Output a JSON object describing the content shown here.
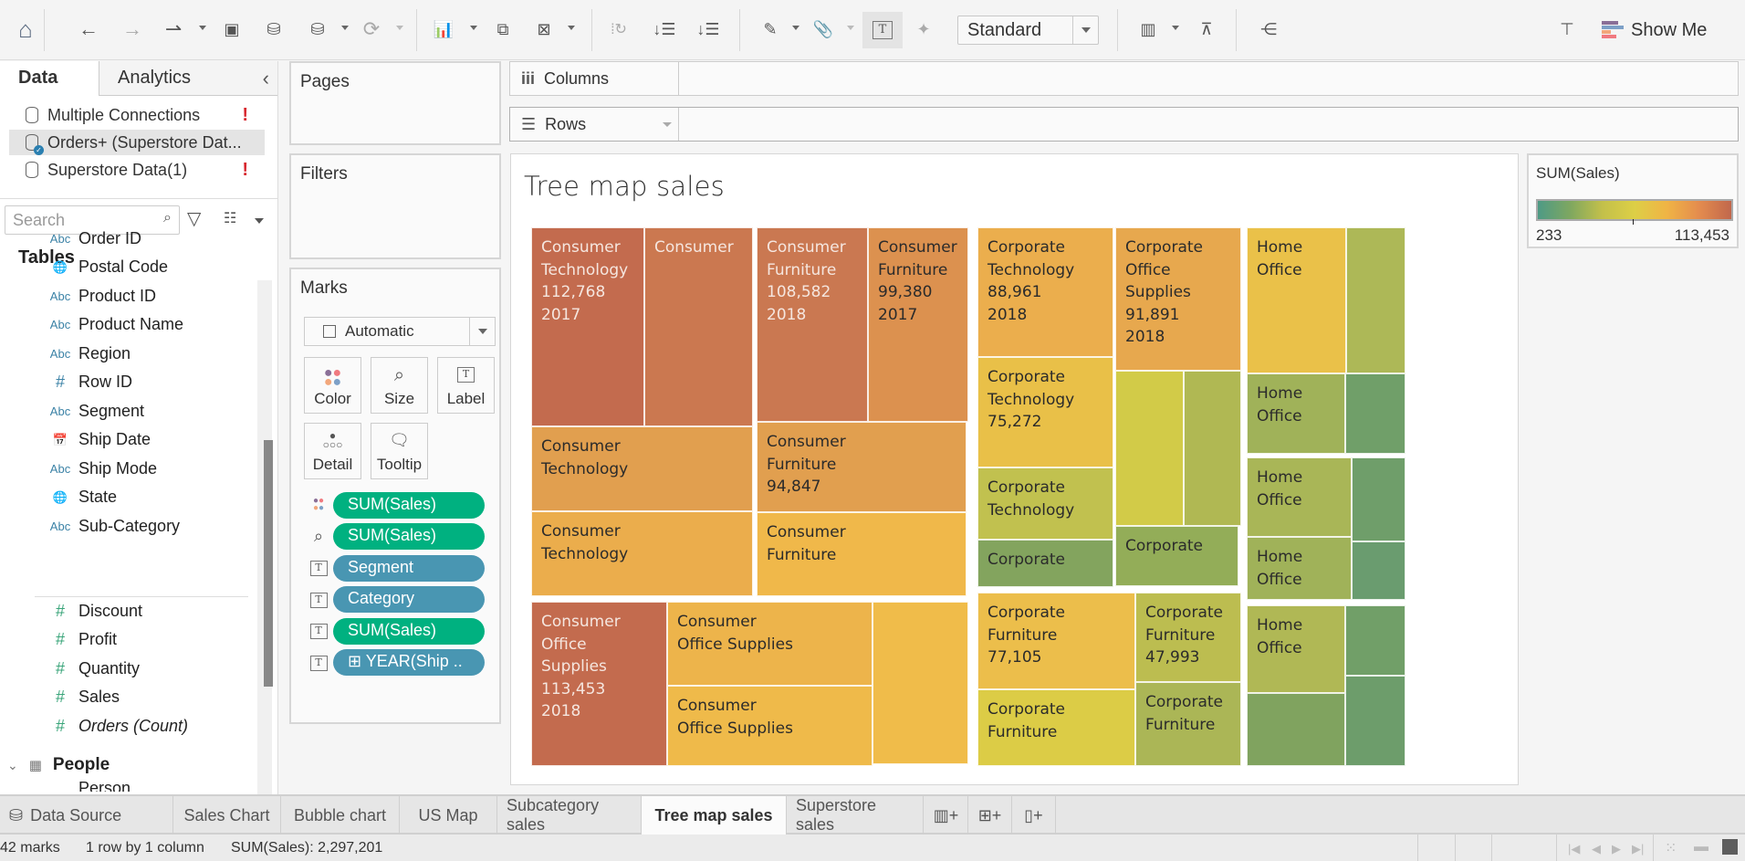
{
  "toolbar": {
    "icons": [
      "home-icon",
      "undo-icon",
      "redo-icon",
      "replay-icon",
      "save-icon",
      "new-data-source-icon",
      "pause-auto-updates-icon",
      "refresh-icon",
      "new-worksheet-icon",
      "duplicate-sheet-icon",
      "clear-sheet-icon",
      "swap-rows-columns-icon",
      "sort-ascending-icon",
      "sort-descending-icon",
      "highlight-icon",
      "group-icon",
      "show-mark-labels-icon",
      "pin-axes-icon",
      "show-cards-icon",
      "presentation-mode-icon",
      "share-icon",
      "guide-icon"
    ],
    "fit_select": "Standard",
    "show_me_label": "Show Me"
  },
  "data_pane": {
    "tabs": [
      "Data",
      "Analytics"
    ],
    "data_sources": [
      {
        "name": "Multiple Connections",
        "warning": "!"
      },
      {
        "name": "Orders+ (Superstore Dat...",
        "warning": "",
        "selected": true
      },
      {
        "name": "Superstore Data(1)",
        "warning": "!"
      }
    ],
    "search_placeholder": "Search",
    "tables_heading": "Tables",
    "dimension_fields": [
      {
        "type": "Abc",
        "name": "Order ID"
      },
      {
        "type": "globe",
        "name": "Postal Code"
      },
      {
        "type": "Abc",
        "name": "Product ID"
      },
      {
        "type": "Abc",
        "name": "Product Name"
      },
      {
        "type": "Abc",
        "name": "Region"
      },
      {
        "type": "#",
        "name": "Row ID"
      },
      {
        "type": "Abc",
        "name": "Segment"
      },
      {
        "type": "date",
        "name": "Ship Date"
      },
      {
        "type": "Abc",
        "name": "Ship Mode"
      },
      {
        "type": "globe",
        "name": "State"
      },
      {
        "type": "Abc",
        "name": "Sub-Category"
      }
    ],
    "measure_fields": [
      {
        "name": "Discount"
      },
      {
        "name": "Profit"
      },
      {
        "name": "Quantity"
      },
      {
        "name": "Sales"
      },
      {
        "name": "Orders (Count)",
        "italic": true
      }
    ],
    "people_table": "People",
    "people_first_field": "Person"
  },
  "cards": {
    "pages": "Pages",
    "filters": "Filters",
    "marks": "Marks",
    "mark_type": "Automatic",
    "mark_buttons": [
      "Color",
      "Size",
      "Label",
      "Detail",
      "Tooltip"
    ],
    "pills": [
      {
        "icon": "color",
        "label": "SUM(Sales)",
        "kind": "measure"
      },
      {
        "icon": "size",
        "label": "SUM(Sales)",
        "kind": "measure"
      },
      {
        "icon": "label",
        "label": "Segment",
        "kind": "dimension"
      },
      {
        "icon": "label",
        "label": "Category",
        "kind": "dimension"
      },
      {
        "icon": "label",
        "label": "SUM(Sales)",
        "kind": "measure"
      },
      {
        "icon": "label",
        "label": "⊞ YEAR(Ship ..",
        "kind": "dimension"
      }
    ]
  },
  "shelves": {
    "columns": "Columns",
    "rows": "Rows"
  },
  "view": {
    "title": "Tree map sales"
  },
  "legend": {
    "title": "SUM(Sales)",
    "min": "233",
    "max": "113,453",
    "colors": [
      "#4e9a86",
      "#ddcf46",
      "#c1674c"
    ]
  },
  "chart_data": {
    "type": "treemap",
    "title": "Tree map sales",
    "size_measure": "SUM(Sales)",
    "color_measure": "SUM(Sales)",
    "color_range": [
      233,
      113453
    ],
    "label_fields": [
      "Segment",
      "Category",
      "SUM(Sales)",
      "YEAR(Ship Date)"
    ],
    "total_marks": 42,
    "total_sales": 2297201,
    "cells": [
      {
        "lines": [
          "Consumer",
          "Technology",
          "112,768",
          "2017"
        ],
        "segment": "Consumer",
        "category": "Technology",
        "value": 112768,
        "year": "2017",
        "color": "#c36b4e",
        "text": "light"
      },
      {
        "lines": [
          "Consumer"
        ],
        "segment": "Consumer",
        "category": "Technology",
        "color": "#cb7850",
        "text": "light"
      },
      {
        "lines": [
          "Consumer",
          "Technology"
        ],
        "segment": "Consumer",
        "category": "Technology",
        "color": "#e19f4f",
        "text": "dark"
      },
      {
        "lines": [
          "Consumer",
          "Technology"
        ],
        "segment": "Consumer",
        "category": "Technology",
        "color": "#ebad4c",
        "text": "dark"
      },
      {
        "lines": [
          "Consumer",
          "Furniture",
          "108,582",
          "2018"
        ],
        "segment": "Consumer",
        "category": "Furniture",
        "value": 108582,
        "year": "2018",
        "color": "#ca7851",
        "text": "light"
      },
      {
        "lines": [
          "Consumer",
          "Furniture",
          "99,380",
          "2017"
        ],
        "segment": "Consumer",
        "category": "Furniture",
        "value": 99380,
        "year": "2017",
        "color": "#dc914f",
        "text": "dark"
      },
      {
        "lines": [
          "Consumer",
          "Furniture",
          "94,847"
        ],
        "segment": "Consumer",
        "category": "Furniture",
        "value": 94847,
        "color": "#e19f4f",
        "text": "dark"
      },
      {
        "lines": [
          "Consumer",
          "Furniture"
        ],
        "segment": "Consumer",
        "category": "Furniture",
        "color": "#f0b84a",
        "text": "dark"
      },
      {
        "lines": [
          "Consumer",
          "Office",
          "Supplies",
          "113,453",
          "2018"
        ],
        "segment": "Consumer",
        "category": "Office Supplies",
        "value": 113453,
        "year": "2018",
        "color": "#c36b4e",
        "text": "light"
      },
      {
        "lines": [
          "Consumer",
          "Office Supplies"
        ],
        "segment": "Consumer",
        "category": "Office Supplies",
        "color": "#edb44b",
        "text": "dark"
      },
      {
        "lines": [
          "Consumer",
          "Office Supplies"
        ],
        "segment": "Consumer",
        "category": "Office Supplies",
        "color": "#efba4a",
        "text": "dark"
      },
      {
        "lines": [],
        "segment": "Consumer",
        "category": "Office Supplies",
        "color": "#f0bc4a",
        "text": "dark"
      },
      {
        "lines": [
          "Corporate",
          "Technology",
          "88,961",
          "2018"
        ],
        "segment": "Corporate",
        "category": "Technology",
        "value": 88961,
        "year": "2018",
        "color": "#ebae4d",
        "text": "dark"
      },
      {
        "lines": [
          "Corporate",
          "Technology",
          "75,272"
        ],
        "segment": "Corporate",
        "category": "Technology",
        "value": 75272,
        "color": "#e9c048",
        "text": "dark"
      },
      {
        "lines": [
          "Corporate",
          "Technology"
        ],
        "segment": "Corporate",
        "category": "Technology",
        "color": "#c1c14f",
        "text": "dark"
      },
      {
        "lines": [
          "Corporate"
        ],
        "segment": "Corporate",
        "category": "Technology",
        "color": "#83a45e",
        "text": "dark"
      },
      {
        "lines": [
          "Corporate",
          "Office",
          "Supplies",
          "91,891",
          "2018"
        ],
        "segment": "Corporate",
        "category": "Office Supplies",
        "value": 91891,
        "year": "2018",
        "color": "#e7a84e",
        "text": "dark"
      },
      {
        "lines": [],
        "segment": "Corporate",
        "category": "Office Supplies",
        "color": "#d2cb48",
        "text": "dark"
      },
      {
        "lines": [],
        "segment": "Corporate",
        "category": "Office Supplies",
        "color": "#b0b853",
        "text": "dark"
      },
      {
        "lines": [
          "Corporate"
        ],
        "segment": "Corporate",
        "category": "Office Supplies",
        "color": "#93ad58",
        "text": "dark"
      },
      {
        "lines": [
          "Corporate",
          "Furniture",
          "77,105"
        ],
        "segment": "Corporate",
        "category": "Furniture",
        "value": 77105,
        "color": "#ecbe4b",
        "text": "dark"
      },
      {
        "lines": [
          "Corporate",
          "Furniture",
          "47,993"
        ],
        "segment": "Corporate",
        "category": "Furniture",
        "value": 47993,
        "color": "#bcbd50",
        "text": "dark"
      },
      {
        "lines": [
          "Corporate",
          "Furniture"
        ],
        "segment": "Corporate",
        "category": "Furniture",
        "color": "#dccc46",
        "text": "dark"
      },
      {
        "lines": [
          "Corporate",
          "Furniture"
        ],
        "segment": "Corporate",
        "category": "Furniture",
        "color": "#abb656",
        "text": "dark"
      },
      {
        "lines": [
          "Home",
          "Office"
        ],
        "segment": "Home Office",
        "color": "#eac149",
        "text": "dark"
      },
      {
        "lines": [],
        "segment": "Home Office",
        "color": "#adb857",
        "text": "dark"
      },
      {
        "lines": [
          "Home",
          "Office"
        ],
        "segment": "Home Office",
        "color": "#a0b259",
        "text": "dark"
      },
      {
        "lines": [],
        "segment": "Home Office",
        "color": "#709f69",
        "text": "dark"
      },
      {
        "lines": [
          "Home",
          "Office"
        ],
        "segment": "Home Office",
        "color": "#a9b657",
        "text": "dark"
      },
      {
        "lines": [],
        "segment": "Home Office",
        "color": "#6f9e6a",
        "text": "dark"
      },
      {
        "lines": [
          "Home",
          "Office"
        ],
        "segment": "Home Office",
        "color": "#a0b259",
        "text": "dark"
      },
      {
        "lines": [],
        "segment": "Home Office",
        "color": "#6a9c6f",
        "text": "dark"
      },
      {
        "lines": [
          "Home",
          "Office"
        ],
        "segment": "Home Office",
        "color": "#b0b855",
        "text": "dark"
      },
      {
        "lines": [],
        "segment": "Home Office",
        "color": "#719f68",
        "text": "dark"
      },
      {
        "lines": [],
        "segment": "Home Office",
        "color": "#80a35f",
        "text": "dark"
      },
      {
        "lines": [],
        "segment": "Home Office",
        "color": "#6d9d6b",
        "text": "dark"
      }
    ]
  },
  "sheet_tabs": {
    "data_source": "Data Source",
    "tabs": [
      "Sales Chart",
      "Bubble chart",
      "US Map",
      "Subcategory sales",
      "Tree map sales",
      "Superstore sales"
    ],
    "active": "Tree map sales",
    "new_buttons": [
      "new-worksheet-icon",
      "new-dashboard-icon",
      "new-story-icon"
    ]
  },
  "status": {
    "marks": "42 marks",
    "layout": "1 row by 1 column",
    "sum": "SUM(Sales): 2,297,201"
  }
}
